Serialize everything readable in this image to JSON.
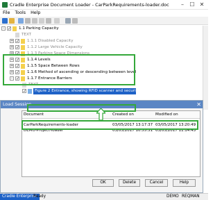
{
  "window": {
    "title": "Cradle Enterprise Document Loader - CarParkRequirements-loader.doc"
  },
  "menu": [
    "File",
    "Tools",
    "Help"
  ],
  "tree": {
    "rows": [
      {
        "indent": 0,
        "text": "1.1 Parking Capacity",
        "gray": false,
        "checked": true,
        "expander": "-"
      },
      {
        "indent": 1,
        "text": "TEXT",
        "gray": true,
        "checked": null,
        "expander": ""
      },
      {
        "indent": 1,
        "text": "1.1.1 Disabled Capacity",
        "gray": true,
        "checked": true,
        "expander": "+"
      },
      {
        "indent": 1,
        "text": "1.1.2 Large Vehicle Capacity",
        "gray": true,
        "checked": true,
        "expander": "+"
      },
      {
        "indent": 1,
        "text": "1.1.3 Parking Space Dimensions",
        "gray": true,
        "checked": true,
        "expander": "+"
      },
      {
        "indent": 1,
        "text": "1.1.4 Levels",
        "gray": false,
        "checked": true,
        "expander": "+"
      },
      {
        "indent": 1,
        "text": "1.1.5 Space Between Rows",
        "gray": false,
        "checked": true,
        "expander": "+"
      },
      {
        "indent": 1,
        "text": "1.1.6 Method of ascending or descending between levels",
        "gray": false,
        "checked": true,
        "expander": "+"
      },
      {
        "indent": 1,
        "text": "1.1.7 Entrance Barriers",
        "gray": false,
        "checked": true,
        "expander": "-"
      },
      {
        "indent": 2,
        "text": "TEXT",
        "gray": true,
        "checked": null,
        "expander": ""
      },
      {
        "indent": 2,
        "text": "Figure 2 Entrance, showing RFID scanner and security barrier",
        "gray": false,
        "checked": true,
        "expander": "",
        "selected": true
      }
    ]
  },
  "dialog": {
    "title": "Load Session",
    "columns": [
      "Document",
      "Created on",
      "Modified on"
    ],
    "rows": [
      {
        "document": "CarParkRequirements-loader",
        "created": "03/05/2017 13:17:37",
        "modified": "03/05/2017 13:20:49"
      },
      {
        "document": "DEMO-Project-loader",
        "created": "03/05/2017 10:55:51",
        "modified": "03/05/2017 11:14:43"
      }
    ],
    "buttons": {
      "ok": "OK",
      "delete": "Delete",
      "cancel": "Cancel",
      "help": "Help"
    }
  },
  "status": {
    "app": "Cradle Enterprise",
    "state": "Ready",
    "database": "DEMO",
    "user": "REQMAN"
  },
  "colors": {
    "highlight": "#34a83a",
    "selection": "#1e62c7",
    "dialog_title": "#5a86c4"
  }
}
